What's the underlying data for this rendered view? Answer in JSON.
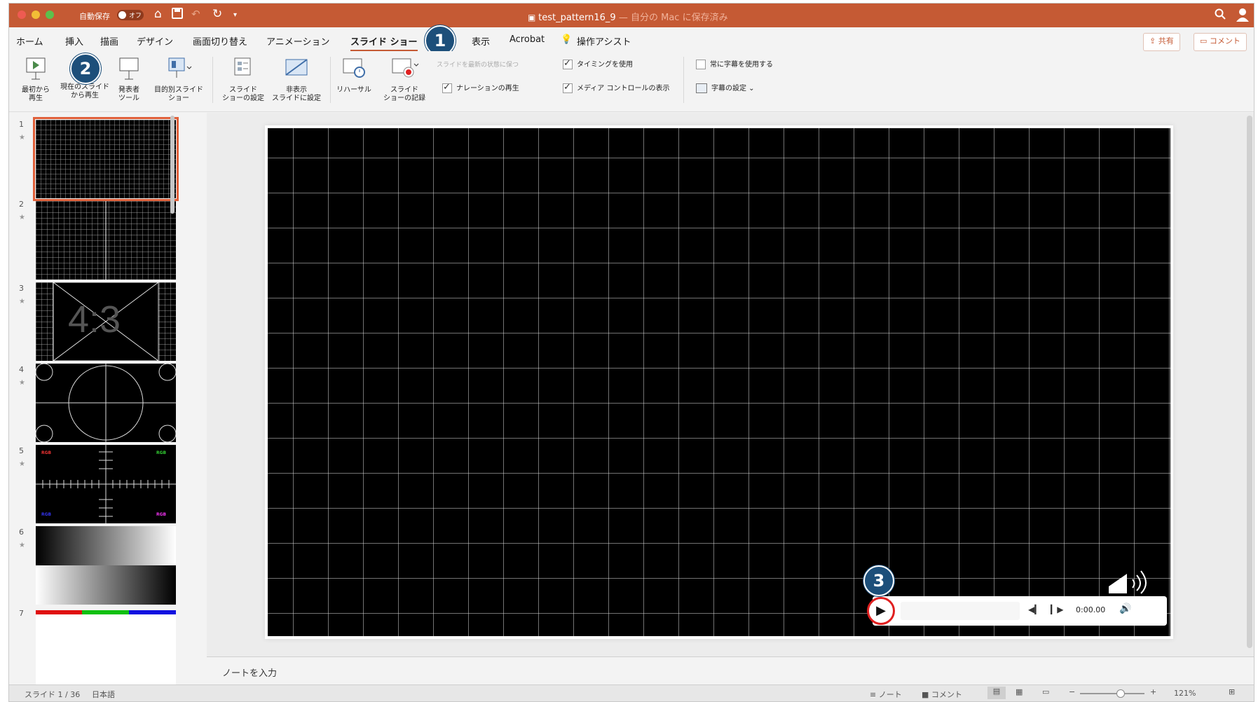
{
  "titlebar": {
    "autosave_label": "自動保存",
    "autosave_state": "オフ",
    "document_title": "test_pattern16_9",
    "document_subtitle": " — 自分の Mac に保存済み"
  },
  "menu": {
    "tabs": [
      "ホーム",
      "挿入",
      "描画",
      "デザイン",
      "画面切り替え",
      "アニメーション",
      "スライド ショー",
      "表示",
      "Acrobat"
    ],
    "active_tab": "スライド ショー",
    "assist": "操作アシスト",
    "share": "共有",
    "comment": "コメント"
  },
  "ribbon": {
    "play_from_start": [
      "最初から",
      "再生"
    ],
    "play_from_current": [
      "現在のスライド",
      "から再生"
    ],
    "presenter_tools": [
      "発表者",
      "ツール"
    ],
    "custom_show": [
      "目的別スライド",
      "ショー"
    ],
    "show_setup": [
      "スライド",
      "ショーの設定"
    ],
    "hide_slide": [
      "非表示",
      "スライドに設定"
    ],
    "rehearse": [
      "リハーサル"
    ],
    "record_show": [
      "スライド",
      "ショーの記録"
    ],
    "keep_updated": "スライドを最新の状態に保つ",
    "play_narrations": "ナレーションの再生",
    "use_timings": "タイミングを使用",
    "show_media_controls": "メディア コントロールの表示",
    "always_subtitles": "常に字幕を使用する",
    "subtitle_settings": "字幕の設定"
  },
  "badges": [
    "1",
    "2",
    "3"
  ],
  "slides": [
    {
      "number": "1",
      "star": "★"
    },
    {
      "number": "2",
      "star": "★"
    },
    {
      "number": "3",
      "star": "★",
      "text": "4:3"
    },
    {
      "number": "4",
      "star": "★"
    },
    {
      "number": "5",
      "star": "★",
      "rgb": "RGB"
    },
    {
      "number": "6",
      "star": "★"
    },
    {
      "number": "7"
    }
  ],
  "media": {
    "time": "0:00.00"
  },
  "notes_placeholder": "ノートを入力",
  "status": {
    "slide_count": "スライド 1 / 36",
    "language": "日本語",
    "notes": "ノート",
    "comments": "コメント",
    "zoom": "121%"
  },
  "colors": {
    "titlebar": "#c55a34",
    "accent": "#e0603a",
    "badge": "#1d4f7a",
    "record_circle": "#e02020"
  }
}
